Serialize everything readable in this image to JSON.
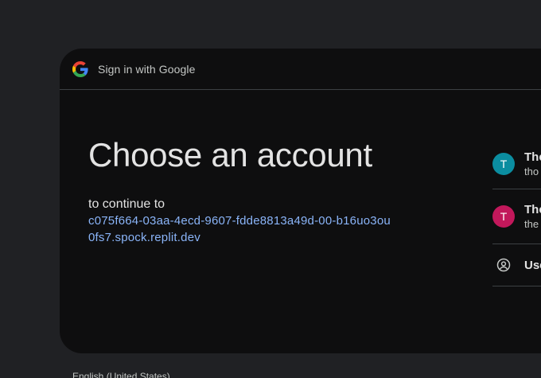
{
  "header": {
    "title": "Sign in with Google"
  },
  "main": {
    "heading": "Choose an account",
    "continue_text": "to continue to",
    "domain": "c075f664-03aa-4ecd-9607-fdde8813a49d-00-b16uo3ou0fs7.spock.replit.dev"
  },
  "accounts": [
    {
      "initial": "T",
      "name": "The",
      "email": "tho",
      "color": "#0b8da0"
    },
    {
      "initial": "T",
      "name": "The",
      "email": "the",
      "color": "#c2185b"
    }
  ],
  "other_account": {
    "label": "Use"
  },
  "footer": {
    "language": "English (United States)"
  },
  "colors": {
    "background": "#202124",
    "card": "#0e0e0f",
    "link": "#8ab4f8"
  }
}
